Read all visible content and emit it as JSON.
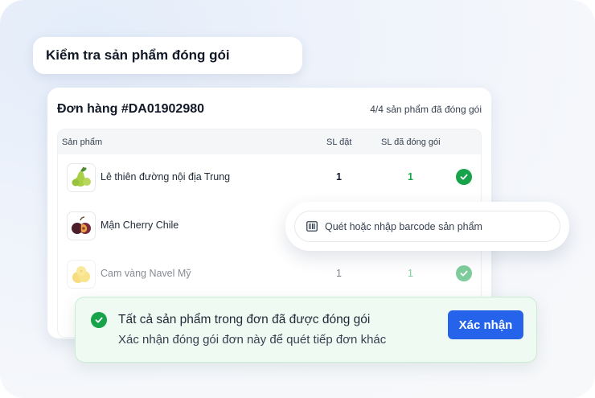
{
  "page_title": "Kiểm tra sản phẩm đóng gói",
  "order": {
    "id_label": "Đơn hàng #DA01902980",
    "packed_summary": "4/4 sản phẩm đã đóng gói"
  },
  "table": {
    "columns": {
      "product": "Sản phẩm",
      "ordered": "SL đặt",
      "packed": "SL đã đóng gói"
    },
    "rows": [
      {
        "name": "Lê thiên đường nội địa Trung",
        "ordered": "1",
        "packed": "1",
        "status": "packed",
        "icon": "pear-icon"
      },
      {
        "name": "Mận Cherry Chile",
        "ordered": "",
        "packed": "",
        "status": "",
        "icon": "plum-icon"
      },
      {
        "name": "Cam vàng Navel Mỹ",
        "ordered": "1",
        "packed": "1",
        "status": "packed",
        "icon": "orange-icon"
      }
    ]
  },
  "scan": {
    "placeholder": "Quét hoặc nhập barcode sản phẩm",
    "icon": "barcode-icon"
  },
  "banner": {
    "title": "Tất cả sản phẩm trong đơn đã được đóng gói",
    "subtitle": "Xác nhận đóng gói đơn này để quét tiếp đơn khác",
    "confirm_label": "Xác nhận",
    "icon": "check-circle-icon"
  },
  "colors": {
    "accent": "#2563eb",
    "success": "#16a34a",
    "banner_bg": "#eefaf2"
  }
}
